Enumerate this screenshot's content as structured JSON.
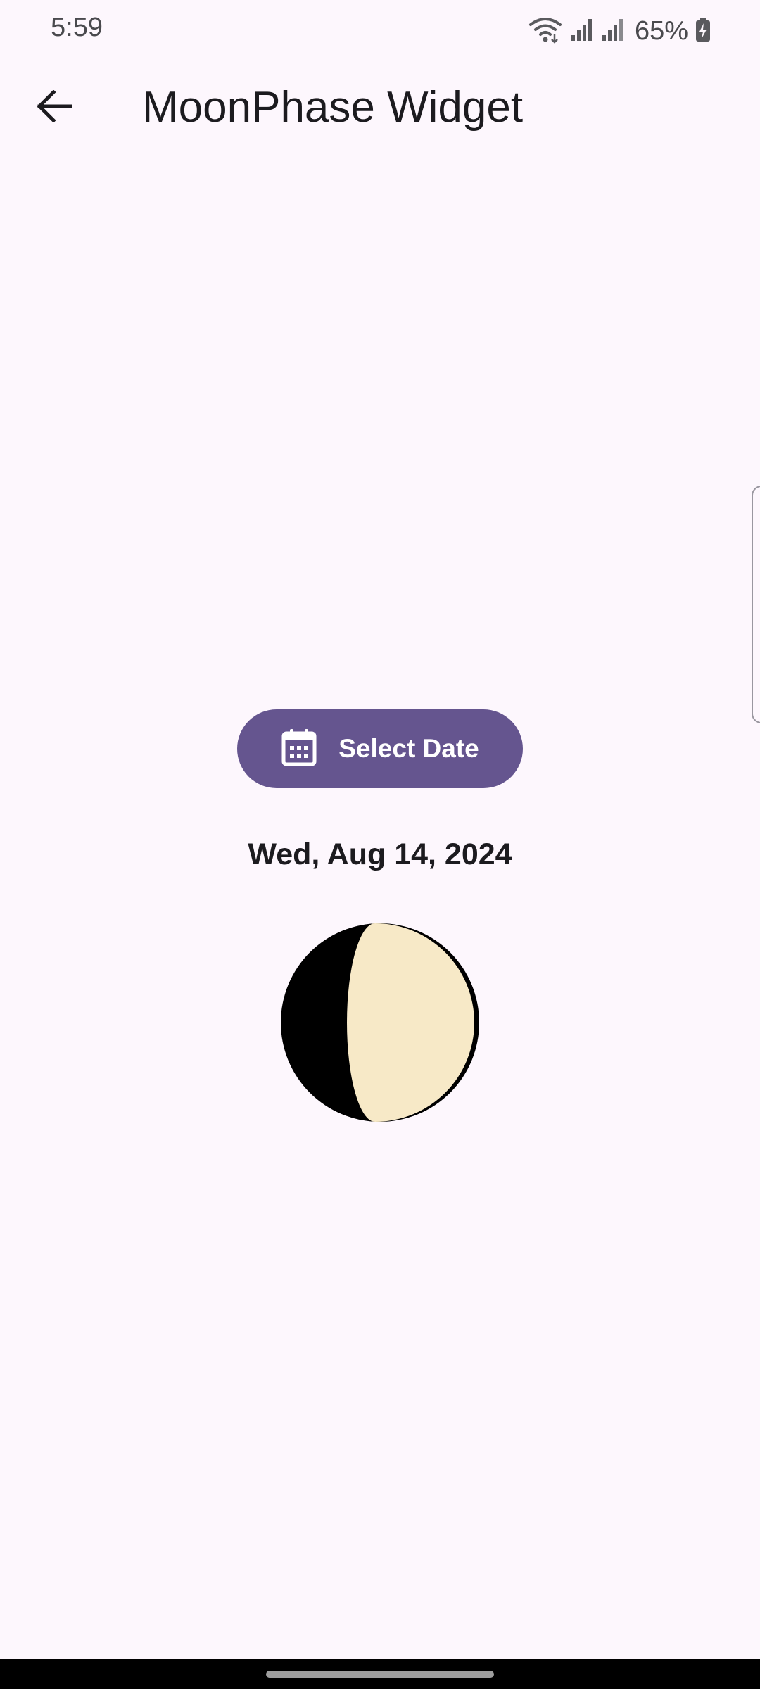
{
  "status_bar": {
    "time": "5:59",
    "battery": "65%",
    "icons": [
      "wifi-icon",
      "signal-icon",
      "signal-icon",
      "battery-charging-icon"
    ]
  },
  "app_bar": {
    "title": "MoonPhase Widget",
    "back_icon": "arrow-back-icon"
  },
  "main": {
    "select_date_label": "Select Date",
    "select_date_icon": "calendar-icon",
    "selected_date": "Wed, Aug 14, 2024"
  },
  "colors": {
    "background": "#FDF7FD",
    "accent": "#65558F",
    "moon_light": "#F7E9C7",
    "moon_dark": "#000000"
  }
}
